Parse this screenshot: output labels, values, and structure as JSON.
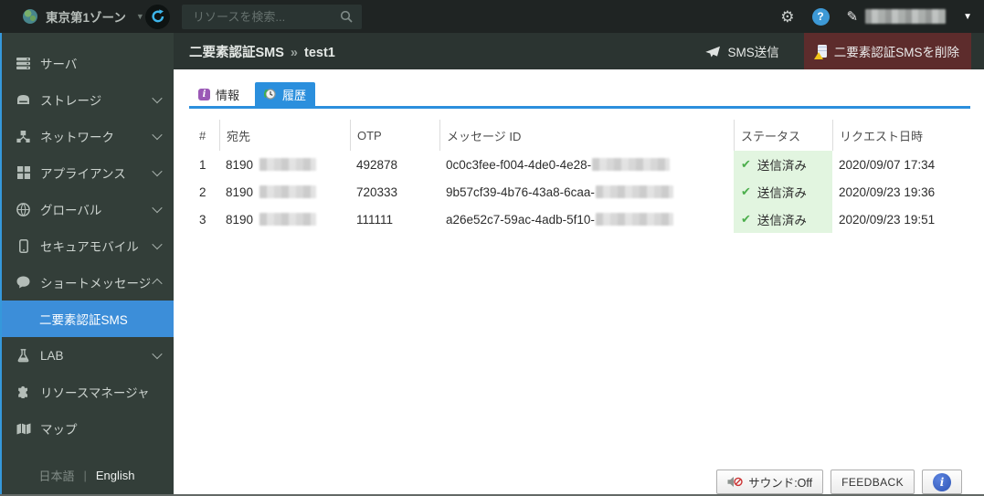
{
  "topbar": {
    "zone_label": "東京第1ゾーン",
    "search_placeholder": "リソースを検索..."
  },
  "icons": {
    "caret_down": "▼",
    "gear": "⚙",
    "help": "?",
    "pencil": "✎",
    "check": "✔",
    "info_i": "i",
    "hash": "#"
  },
  "sidebar": {
    "items": [
      {
        "label": "サーバ"
      },
      {
        "label": "ストレージ"
      },
      {
        "label": "ネットワーク"
      },
      {
        "label": "アプライアンス"
      },
      {
        "label": "グローバル"
      },
      {
        "label": "セキュアモバイル"
      },
      {
        "label": "ショートメッセージ"
      },
      {
        "label": "LAB"
      },
      {
        "label": "リソースマネージャ"
      },
      {
        "label": "マップ"
      }
    ],
    "active_submenu": "二要素認証SMS",
    "lang_ja": "日本語",
    "lang_divider": "|",
    "lang_en": "English"
  },
  "header": {
    "breadcrumb_root": "二要素認証SMS",
    "breadcrumb_sep": "»",
    "breadcrumb_current": "test1",
    "sms_send_label": "SMS送信",
    "delete_label": "二要素認証SMSを削除"
  },
  "tabs": {
    "info": "情報",
    "history": "履歴"
  },
  "table": {
    "columns": {
      "num": "#",
      "to": "宛先",
      "otp": "OTP",
      "msgid": "メッセージ ID",
      "status": "ステータス",
      "requested": "リクエスト日時"
    },
    "rows": [
      {
        "num": "1",
        "to": "8190",
        "otp": "492878",
        "msgid": "0c0c3fee-f004-4de0-4e28-",
        "status": "送信済み",
        "requested": "2020/09/07 17:34"
      },
      {
        "num": "2",
        "to": "8190",
        "otp": "720333",
        "msgid": "9b57cf39-4b76-43a8-6caa-",
        "status": "送信済み",
        "requested": "2020/09/23 19:36"
      },
      {
        "num": "3",
        "to": "8190",
        "otp": "111111",
        "msgid": "a26e52c7-59ac-4adb-5f10-",
        "status": "送信済み",
        "requested": "2020/09/23 19:51"
      }
    ]
  },
  "footer": {
    "sound_label": "サウンド:Off",
    "feedback_label": "FEEDBACK"
  },
  "colors": {
    "accent_blue": "#2b8fdd",
    "selected_blue": "#3c8ed9",
    "delete_red": "#5d2c2c",
    "status_green_bg": "#e2f5e0",
    "check_green": "#4cae4c"
  }
}
